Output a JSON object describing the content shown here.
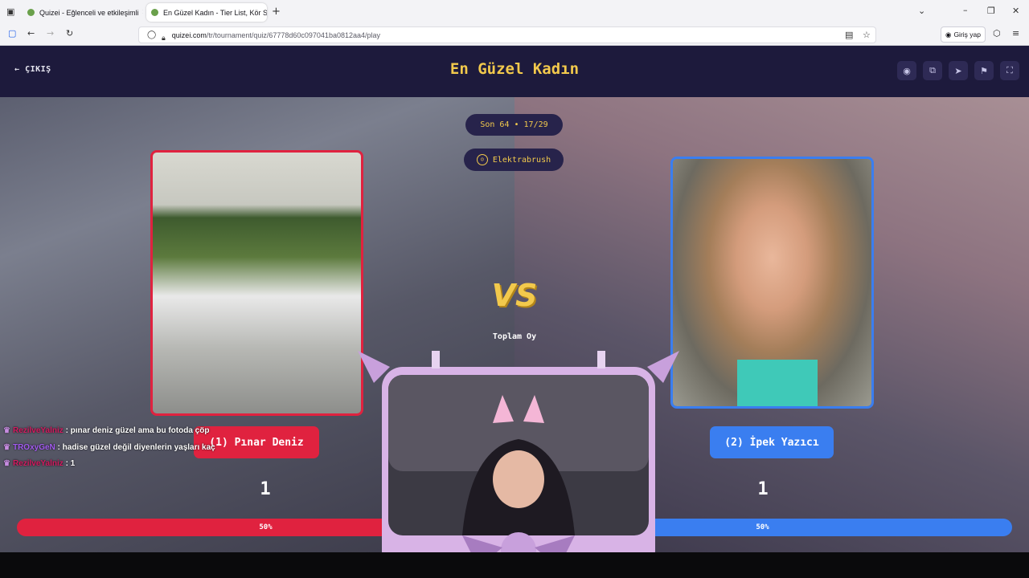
{
  "browser": {
    "tabs": [
      {
        "label": "Quizei - Eğlenceli ve etkileşimli"
      },
      {
        "label": "En Güzel Kadın - Tier List, Kör S"
      }
    ],
    "url_host": "quizei.com",
    "url_path": "/tr/tournament/quiz/67778d60c097041ba0812aa4/play",
    "signin_label": "Giriş yap"
  },
  "header": {
    "exit_label": "ÇIKIŞ",
    "title": "En Güzel Kadın"
  },
  "round": {
    "label": "Son 64 • 17/29",
    "creator": "Elektrabrush"
  },
  "left": {
    "name": "(1) Pınar Deniz",
    "votes": "1",
    "percent_label": "50%",
    "percent": 50,
    "color": "#e0223f"
  },
  "right": {
    "name": "(2) İpek Yazıcı",
    "votes": "1",
    "percent_label": "50%",
    "percent": 50,
    "color": "#3a7ef0"
  },
  "vs_label": "VS",
  "total_label": "Toplam Oy",
  "chat": [
    {
      "user": "RezilveYalniz",
      "text": ": pınar deniz güzel ama bu fotoda çöp"
    },
    {
      "user": "TROxyGeN",
      "text": ": hadise güzel değil diyenlerin yaşları kaç"
    },
    {
      "user": "RezilveYalniz",
      "text": ": 1"
    }
  ],
  "icons": [
    "eye-icon",
    "share-icon",
    "send-icon",
    "flag-icon",
    "fullscreen-icon"
  ]
}
